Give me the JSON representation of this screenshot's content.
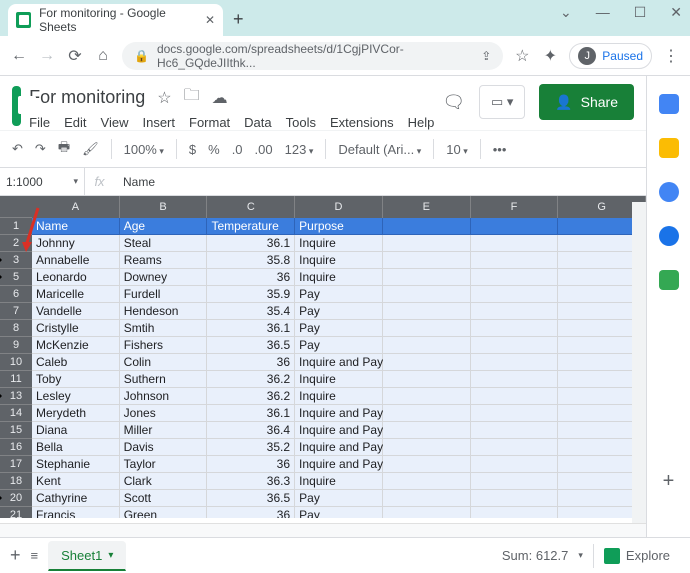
{
  "browser": {
    "tab_title": "For monitoring - Google Sheets",
    "url": "docs.google.com/spreadsheets/d/1CgjPIVCor-Hc6_GQdeJIIthk...",
    "profile_letter": "J",
    "profile_status": "Paused"
  },
  "doc": {
    "title": "For monitoring",
    "menus": [
      "File",
      "Edit",
      "View",
      "Insert",
      "Format",
      "Data",
      "Tools",
      "Extensions",
      "Help"
    ],
    "share_label": "Share"
  },
  "toolbar": {
    "zoom": "100%",
    "currency": "$",
    "percent": "%",
    "dec_dec": ".0",
    "dec_inc": ".00",
    "format123": "123",
    "font": "Default (Ari...",
    "font_size": "10",
    "more": "•••"
  },
  "namebox": "1:1000",
  "formula_value": "Name",
  "columns": [
    "A",
    "B",
    "C",
    "D",
    "E",
    "F",
    "G"
  ],
  "row_numbers": [
    "1",
    "2",
    "3",
    "5",
    "6",
    "7",
    "8",
    "9",
    "10",
    "11",
    "13",
    "14",
    "15",
    "16",
    "17",
    "18",
    "20",
    "21"
  ],
  "row_markers": [
    2,
    3,
    10,
    16
  ],
  "chart_data": {
    "type": "table",
    "headers": [
      "Name",
      "Age",
      "Temperature",
      "Purpose"
    ],
    "rows": [
      [
        "Johnny",
        "Steal",
        "36.1",
        "Inquire"
      ],
      [
        "Annabelle",
        "Reams",
        "35.8",
        "Inquire"
      ],
      [
        "Leonardo",
        "Downey",
        "36",
        "Inquire"
      ],
      [
        "Maricelle",
        "Furdell",
        "35.9",
        "Pay"
      ],
      [
        "Vandelle",
        "Hendeson",
        "35.4",
        "Pay"
      ],
      [
        "Cristylle",
        "Smtih",
        "36.1",
        "Pay"
      ],
      [
        "McKenzie",
        "Fishers",
        "36.5",
        "Pay"
      ],
      [
        "Caleb",
        "Colin",
        "36",
        "Inquire and Pay"
      ],
      [
        "Toby",
        "Suthern",
        "36.2",
        "Inquire"
      ],
      [
        "Lesley",
        "Johnson",
        "36.2",
        "Inquire"
      ],
      [
        "Merydeth",
        "Jones",
        "36.1",
        "Inquire and Pay"
      ],
      [
        "Diana",
        "Miller",
        "36.4",
        "Inquire and Pay"
      ],
      [
        "Bella",
        "Davis",
        "35.2",
        "Inquire and Pay"
      ],
      [
        "Stephanie",
        "Taylor",
        "36",
        "Inquire and Pay"
      ],
      [
        "Kent",
        "Clark",
        "36.3",
        "Inquire"
      ],
      [
        "Cathyrine",
        "Scott",
        "36.5",
        "Pay"
      ],
      [
        "Francis",
        "Green",
        "36",
        "Pay"
      ]
    ]
  },
  "sheet_tab": "Sheet1",
  "status_sum": "Sum: 612.7",
  "explore_label": "Explore"
}
